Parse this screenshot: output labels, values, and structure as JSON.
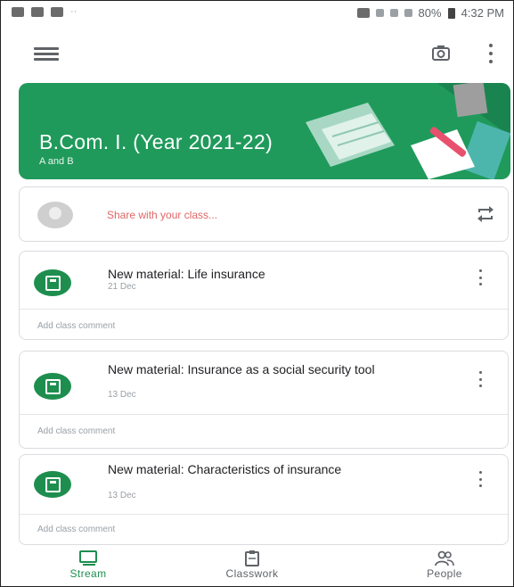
{
  "status_bar": {
    "extra": "··",
    "battery": "80%",
    "time": "4:32 PM"
  },
  "app_bar": {
    "icons": [
      "menu-icon",
      "camera-icon",
      "more-vert-icon"
    ]
  },
  "class": {
    "title": "B.Com. I.  (Year 2021-22)",
    "section": "A and B",
    "banner_color": "#1f9a5b"
  },
  "share": {
    "placeholder": "Share with your class..."
  },
  "posts": [
    {
      "headline": "New material: Life insurance",
      "date": "21 Dec",
      "comment_prompt": "Add class comment"
    },
    {
      "headline": "New material: Insurance as a social security tool",
      "date": "13 Dec",
      "comment_prompt": "Add class comment"
    },
    {
      "headline": "New material: Characteristics of insurance",
      "date": "13 Dec",
      "comment_prompt": "Add class comment"
    }
  ],
  "bottom_nav": {
    "items": [
      {
        "label": "Stream",
        "icon": "stream-icon",
        "active": true
      },
      {
        "label": "Classwork",
        "icon": "classwork-icon",
        "active": false
      },
      {
        "label": "People",
        "icon": "people-icon",
        "active": false
      }
    ]
  },
  "colors": {
    "accent": "#1e8e4f",
    "share_prompt": "#e06666"
  }
}
